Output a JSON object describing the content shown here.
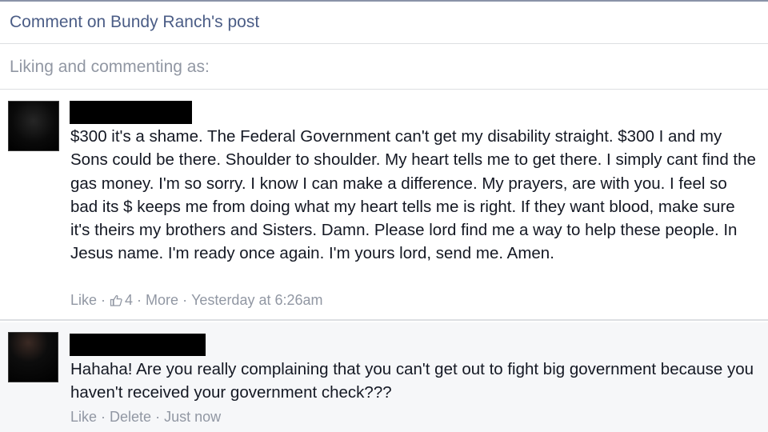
{
  "header": {
    "title": "Comment on Bundy Ranch's post"
  },
  "liking": {
    "text": "Liking and commenting as:"
  },
  "comments": [
    {
      "text": "$300 it's a shame. The Federal Government can't get my disability straight. $300 I and my Sons could be there. Shoulder to shoulder. My heart tells me to get there. I simply cant find the gas money. I'm so sorry. I know I can make a difference. My prayers, are with you. I feel so bad its $ keeps me from doing what my heart tells me is right. If they want blood, make sure it's theirs my brothers and Sisters. Damn. Please lord find me a way to help these people. In Jesus name. I'm ready once again. I'm yours lord, send me. Amen.",
      "like_label": "Like",
      "like_count": "4",
      "more_label": "More",
      "timestamp": "Yesterday at 6:26am",
      "like_icon": "thumbs-up-icon"
    },
    {
      "text": "Hahaha! Are you really complaining that you can't get out to fight big government because you haven't received your government check???",
      "like_label": "Like",
      "delete_label": "Delete",
      "timestamp": "Just now"
    }
  ],
  "separator": "·",
  "colors": {
    "header_text": "#4b5d86",
    "muted_text": "#9197a3",
    "body_text": "#141823",
    "highlight_bg": "#f6f7f9"
  }
}
